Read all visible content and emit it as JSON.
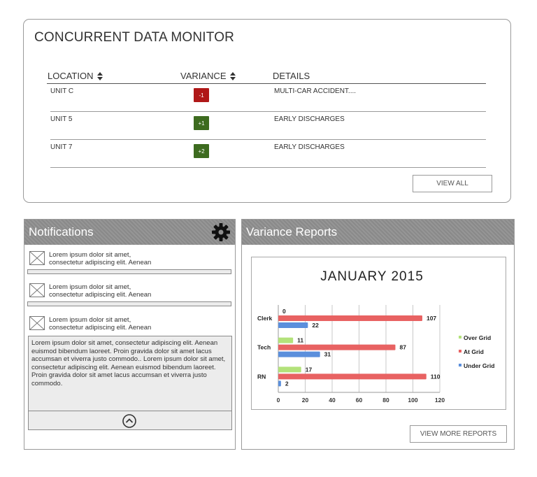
{
  "monitor": {
    "title": "CONCURRENT DATA MONITOR",
    "columns": {
      "location": "LOCATION",
      "variance": "VARIANCE",
      "details": "DETAILS"
    },
    "rows": [
      {
        "location": "UNIT C",
        "variance": "-1",
        "variance_color": "#b01818",
        "details": "MULTI-CAR ACCIDENT...."
      },
      {
        "location": "UNIT 5",
        "variance": "+1",
        "variance_color": "#3d6b1f",
        "details": "EARLY DISCHARGES"
      },
      {
        "location": "UNIT 7",
        "variance": "+2",
        "variance_color": "#3d6b1f",
        "details": "EARLY DISCHARGES"
      }
    ],
    "view_all_label": "VIEW ALL"
  },
  "notifications": {
    "title": "Notifications",
    "settings_icon": "gear-icon",
    "items": [
      {
        "line1": "Lorem ipsum dolor sit amet,",
        "line2": "consectetur adipiscing elit. Aenean"
      },
      {
        "line1": "Lorem ipsum dolor sit amet,",
        "line2": "consectetur adipiscing elit. Aenean"
      },
      {
        "line1": "Lorem ipsum dolor sit amet,",
        "line2": "consectetur adipiscing elit. Aenean"
      }
    ],
    "expanded_text": "Lorem ipsum dolor sit amet, consectetur adipiscing elit. Aenean euismod bibendum laoreet. Proin gravida dolor sit amet lacus accumsan et viverra justo commodo.. Lorem ipsum dolor sit amet, consectetur adipiscing elit. Aenean euismod bibendum laoreet. Proin gravida dolor sit amet lacus accumsan et viverra justo commodo.",
    "collapse_icon": "chevron-up-circle-icon"
  },
  "reports": {
    "title": "Variance Reports",
    "more_label": "VIEW MORE REPORTS"
  },
  "chart_data": {
    "type": "bar",
    "orientation": "horizontal",
    "title": "JANUARY 2015",
    "categories": [
      "Clerk",
      "Tech",
      "RN"
    ],
    "series": [
      {
        "name": "Over Grid",
        "color": "#b3e27a",
        "values": [
          0,
          11,
          17
        ]
      },
      {
        "name": "At Grid",
        "color": "#e86262",
        "values": [
          107,
          87,
          110
        ]
      },
      {
        "name": "Under Grid",
        "color": "#5b8fdc",
        "values": [
          22,
          31,
          2
        ]
      }
    ],
    "xlim": [
      0,
      120
    ],
    "xticks": [
      0,
      20,
      40,
      60,
      80,
      100,
      120
    ],
    "grid": true,
    "legend": "right"
  }
}
